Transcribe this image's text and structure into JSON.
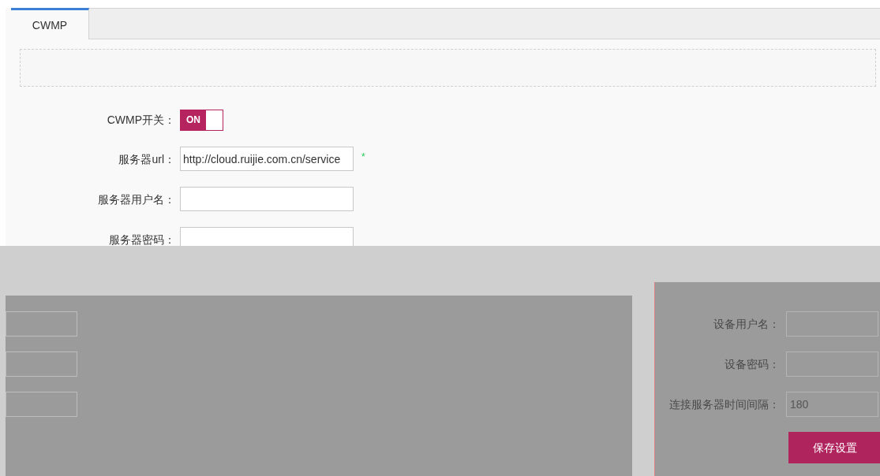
{
  "tabs": [
    {
      "label": "CWMP",
      "selected": true
    }
  ],
  "cwmp_form": {
    "switch": {
      "label": "CWMP开关：",
      "on": true,
      "text": "ON"
    },
    "fields": [
      {
        "label": "服务器url：",
        "value": "http://cloud.ruijie.com.cn/service",
        "required_mark": "*"
      },
      {
        "label": "服务器用户名："
      },
      {
        "label": "服务器密码："
      }
    ]
  },
  "device_form": {
    "fields": [
      {
        "label": "设备用户名："
      },
      {
        "label": "设备密码："
      },
      {
        "label": "连接服务器时间间隔：",
        "value": "180"
      }
    ],
    "save_button": "保存设置"
  }
}
